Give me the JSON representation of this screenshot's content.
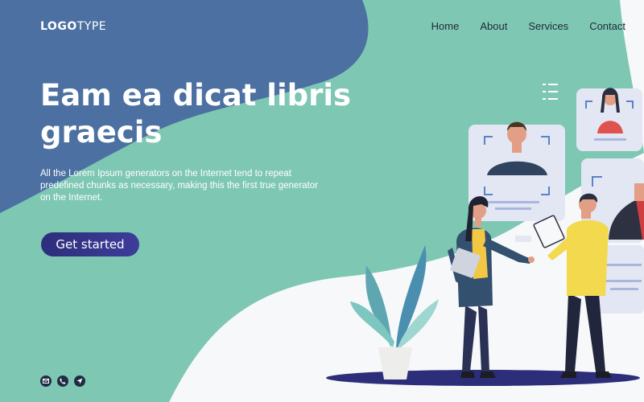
{
  "brand": {
    "logo_bold": "LOGO",
    "logo_light": "TYPE"
  },
  "nav": {
    "items": [
      "Home",
      "About",
      "Services",
      "Contact"
    ]
  },
  "hero": {
    "title": "Eam ea dicat libris graecis",
    "description": "All the Lorem Ipsum generators on the Internet tend to repeat predefined chunks as necessary, making this the first true generator on the Internet.",
    "cta_label": "Get started"
  },
  "social": {
    "icons": [
      "mail-icon",
      "phone-icon",
      "send-icon"
    ]
  },
  "colors": {
    "teal": "#7ec7b3",
    "blue": "#4b70a1",
    "white": "#f7f8fa",
    "navy": "#2d2e7a"
  }
}
